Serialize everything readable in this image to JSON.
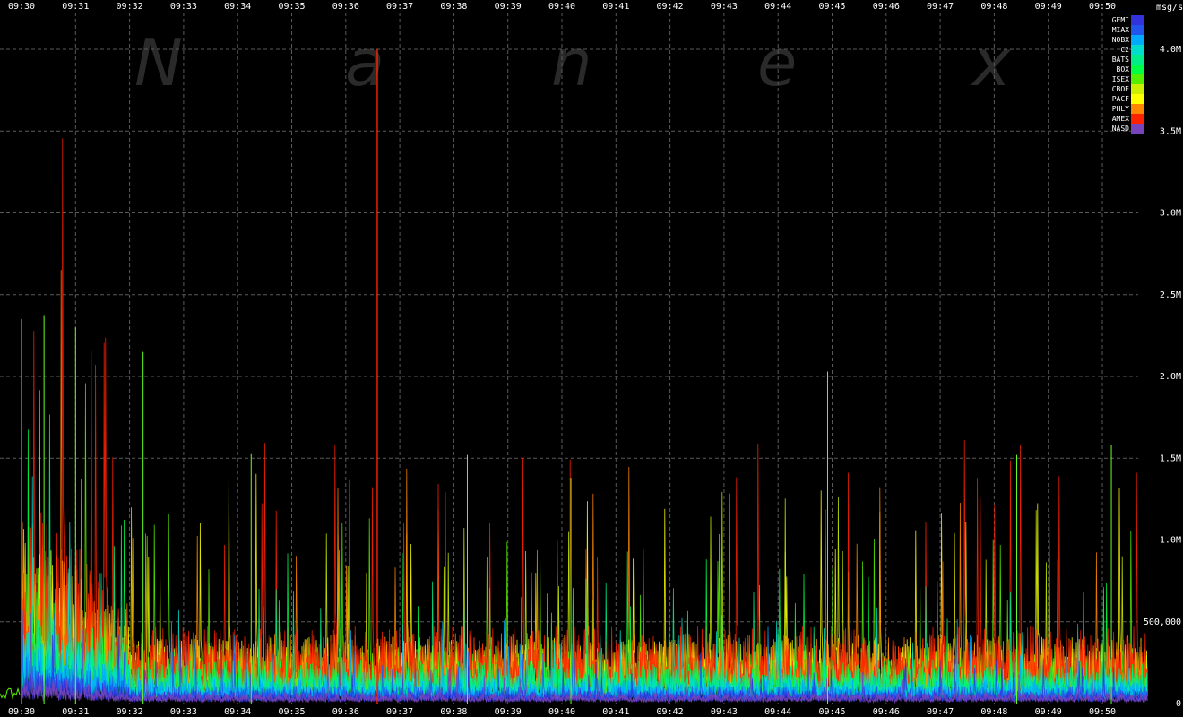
{
  "watermark_letters": [
    "N",
    "a",
    "n",
    "e",
    "x"
  ],
  "chart_data": {
    "type": "area",
    "title": "",
    "xlabel": "",
    "ylabel": "msg/s",
    "ylim": [
      0,
      4200000
    ],
    "grid": true,
    "legend_placement": "top-right",
    "x_ticks": [
      "09:30",
      "09:31",
      "09:32",
      "09:33",
      "09:34",
      "09:35",
      "09:36",
      "09:37",
      "09:38",
      "09:39",
      "09:40",
      "09:41",
      "09:42",
      "09:43",
      "09:44",
      "09:45",
      "09:46",
      "09:47",
      "09:48",
      "09:49",
      "09:50"
    ],
    "y_ticks": [
      {
        "value": 0,
        "label": "0"
      },
      {
        "value": 500000,
        "label": "500,000"
      },
      {
        "value": 1000000,
        "label": "1.0M"
      },
      {
        "value": 1500000,
        "label": "1.5M"
      },
      {
        "value": 2000000,
        "label": "2.0M"
      },
      {
        "value": 2500000,
        "label": "2.5M"
      },
      {
        "value": 3000000,
        "label": "3.0M"
      },
      {
        "value": 3500000,
        "label": "3.5M"
      },
      {
        "value": 4000000,
        "label": "4.0M"
      }
    ],
    "series": [
      {
        "name": "GEMI",
        "color": "#3333dd"
      },
      {
        "name": "MIAX",
        "color": "#2255ee"
      },
      {
        "name": "NOBX",
        "color": "#00aaff"
      },
      {
        "name": "C2",
        "color": "#00ddcc"
      },
      {
        "name": "BATS",
        "color": "#00ee88"
      },
      {
        "name": "BOX",
        "color": "#00ff44"
      },
      {
        "name": "ISEX",
        "color": "#55ee00"
      },
      {
        "name": "CBOE",
        "color": "#ccee00"
      },
      {
        "name": "PACF",
        "color": "#ffff00"
      },
      {
        "name": "PHLY",
        "color": "#ff8800"
      },
      {
        "name": "AMEX",
        "color": "#ff2200"
      },
      {
        "name": "NASD",
        "color": "#7744bb"
      }
    ],
    "x_range": [
      "09:30",
      "09:50:50"
    ],
    "peaks": [
      {
        "x": "09:30:00",
        "y": 2350000
      },
      {
        "x": "09:30:25",
        "y": 2370000
      },
      {
        "x": "09:31:00",
        "y": 2300000
      },
      {
        "x": "09:32:15",
        "y": 2150000
      },
      {
        "x": "09:34:15",
        "y": 1530000
      },
      {
        "x": "09:36:35",
        "y": 4000000
      },
      {
        "x": "09:38:15",
        "y": 1520000
      },
      {
        "x": "09:40:10",
        "y": 1380000
      },
      {
        "x": "09:44:55",
        "y": 2030000
      },
      {
        "x": "09:48:25",
        "y": 1520000
      },
      {
        "x": "09:50:10",
        "y": 1580000
      }
    ],
    "baseline_typical": 300000
  }
}
